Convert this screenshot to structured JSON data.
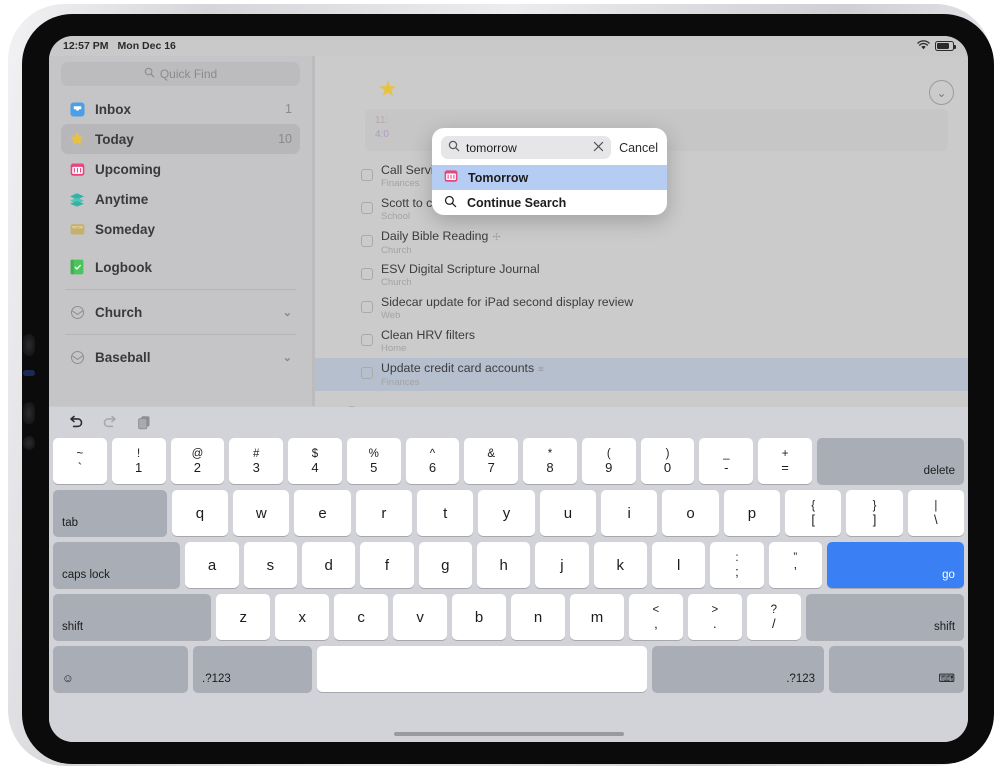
{
  "statusbar": {
    "time": "12:57 PM",
    "date": "Mon Dec 16",
    "wifi_icon": "wifi-icon",
    "battery_icon": "battery-icon"
  },
  "sidebar": {
    "quick_find_placeholder": "Quick Find",
    "search_icon": "search-icon",
    "items": [
      {
        "label": "Inbox",
        "count": "1",
        "icon": "inbox-icon",
        "color": "#4a9fe8",
        "selected": false
      },
      {
        "label": "Today",
        "count": "10",
        "icon": "star-icon",
        "color": "#e8c140",
        "selected": true
      },
      {
        "label": "Upcoming",
        "count": "",
        "icon": "calendar-icon",
        "color": "#e8457c",
        "selected": false
      },
      {
        "label": "Anytime",
        "count": "",
        "icon": "layers-icon",
        "color": "#2fb4a6",
        "selected": false
      },
      {
        "label": "Someday",
        "count": "",
        "icon": "box-icon",
        "color": "#c6b06a",
        "selected": false
      },
      {
        "label": "Logbook",
        "count": "",
        "icon": "logbook-icon",
        "color": "#4cc45e",
        "selected": false
      }
    ],
    "areas": [
      {
        "label": "Church",
        "icon": "area-icon",
        "chevron": "chevron-down-icon"
      },
      {
        "label": "Baseball",
        "icon": "area-icon",
        "chevron": "chevron-down-icon"
      }
    ]
  },
  "content": {
    "star_icon": "star-icon",
    "ghost_card": {
      "line1": "11:",
      "line2": "4:0"
    },
    "tasks": [
      {
        "title": "Call Service Canada",
        "sub": "Finances",
        "badge": "",
        "selected": false
      },
      {
        "title": "Scott to confirm PER report for PERT",
        "sub": "School",
        "badge": "",
        "selected": false
      },
      {
        "title": "Daily Bible Reading",
        "sub": "Church",
        "badge": "☩",
        "selected": false
      },
      {
        "title": "ESV Digital Scripture Journal",
        "sub": "Church",
        "badge": "",
        "selected": false
      },
      {
        "title": "Sidecar update for iPad second display review",
        "sub": "Web",
        "badge": "",
        "selected": false
      },
      {
        "title": "Clean HRV filters",
        "sub": "Home",
        "badge": "",
        "selected": false
      },
      {
        "title": "Update credit card accounts",
        "sub": "Finances",
        "badge": "≡",
        "selected": true
      }
    ]
  },
  "popover": {
    "search_icon": "search-icon",
    "query": "tomorrow",
    "clear_icon": "close-icon",
    "cancel_label": "Cancel",
    "results": [
      {
        "label": "Tomorrow",
        "icon": "calendar-icon",
        "highlighted": true
      },
      {
        "label": "Continue Search",
        "icon": "search-icon",
        "highlighted": false
      }
    ]
  },
  "toolbar": {
    "undo_icon": "undo-icon",
    "redo_icon": "redo-icon",
    "paste_icon": "paste-icon",
    "collapse_icon": "chevron-down-circle-icon"
  },
  "keyboard": {
    "rows": [
      [
        {
          "type": "dual",
          "up": "~",
          "lo": "`",
          "name": "key-backtick"
        },
        {
          "type": "dual",
          "up": "!",
          "lo": "1",
          "name": "key-1"
        },
        {
          "type": "dual",
          "up": "@",
          "lo": "2",
          "name": "key-2"
        },
        {
          "type": "dual",
          "up": "#",
          "lo": "3",
          "name": "key-3"
        },
        {
          "type": "dual",
          "up": "$",
          "lo": "4",
          "name": "key-4"
        },
        {
          "type": "dual",
          "up": "%",
          "lo": "5",
          "name": "key-5"
        },
        {
          "type": "dual",
          "up": "^",
          "lo": "6",
          "name": "key-6"
        },
        {
          "type": "dual",
          "up": "&",
          "lo": "7",
          "name": "key-7"
        },
        {
          "type": "dual",
          "up": "*",
          "lo": "8",
          "name": "key-8"
        },
        {
          "type": "dual",
          "up": "(",
          "lo": "9",
          "name": "key-9"
        },
        {
          "type": "dual",
          "up": ")",
          "lo": "0",
          "name": "key-0"
        },
        {
          "type": "dual",
          "up": "_",
          "lo": "-",
          "name": "key-minus"
        },
        {
          "type": "dual",
          "up": "+",
          "lo": "=",
          "name": "key-equals"
        },
        {
          "type": "mod-right",
          "label": "delete",
          "flex": 2.4,
          "name": "key-delete"
        }
      ],
      [
        {
          "type": "mod-left",
          "label": "tab",
          "flex": 1.7,
          "name": "key-tab"
        },
        {
          "type": "single",
          "label": "q",
          "name": "key-q"
        },
        {
          "type": "single",
          "label": "w",
          "name": "key-w"
        },
        {
          "type": "single",
          "label": "e",
          "name": "key-e"
        },
        {
          "type": "single",
          "label": "r",
          "name": "key-r"
        },
        {
          "type": "single",
          "label": "t",
          "name": "key-t"
        },
        {
          "type": "single",
          "label": "y",
          "name": "key-y"
        },
        {
          "type": "single",
          "label": "u",
          "name": "key-u"
        },
        {
          "type": "single",
          "label": "i",
          "name": "key-i"
        },
        {
          "type": "single",
          "label": "o",
          "name": "key-o"
        },
        {
          "type": "single",
          "label": "p",
          "name": "key-p"
        },
        {
          "type": "dual",
          "up": "{",
          "lo": "[",
          "name": "key-bracket-left"
        },
        {
          "type": "dual",
          "up": "}",
          "lo": "]",
          "name": "key-bracket-right"
        },
        {
          "type": "dual",
          "up": "|",
          "lo": "\\",
          "name": "key-backslash"
        }
      ],
      [
        {
          "type": "mod-left",
          "label": "caps lock",
          "flex": 2.05,
          "name": "key-caps-lock"
        },
        {
          "type": "single",
          "label": "a",
          "name": "key-a"
        },
        {
          "type": "single",
          "label": "s",
          "name": "key-s"
        },
        {
          "type": "single",
          "label": "d",
          "name": "key-d"
        },
        {
          "type": "single",
          "label": "f",
          "name": "key-f"
        },
        {
          "type": "single",
          "label": "g",
          "name": "key-g"
        },
        {
          "type": "single",
          "label": "h",
          "name": "key-h"
        },
        {
          "type": "single",
          "label": "j",
          "name": "key-j"
        },
        {
          "type": "single",
          "label": "k",
          "name": "key-k"
        },
        {
          "type": "single",
          "label": "l",
          "name": "key-l"
        },
        {
          "type": "dual",
          "up": ":",
          "lo": ";",
          "name": "key-semicolon"
        },
        {
          "type": "dual",
          "up": "”",
          "lo": "’",
          "name": "key-quote"
        },
        {
          "type": "go",
          "label": "go",
          "flex": 2.4,
          "name": "key-go"
        }
      ],
      [
        {
          "type": "mod-left",
          "label": "shift",
          "flex": 2.6,
          "name": "key-shift-left"
        },
        {
          "type": "single",
          "label": "z",
          "name": "key-z"
        },
        {
          "type": "single",
          "label": "x",
          "name": "key-x"
        },
        {
          "type": "single",
          "label": "c",
          "name": "key-c"
        },
        {
          "type": "single",
          "label": "v",
          "name": "key-v"
        },
        {
          "type": "single",
          "label": "b",
          "name": "key-b"
        },
        {
          "type": "single",
          "label": "n",
          "name": "key-n"
        },
        {
          "type": "single",
          "label": "m",
          "name": "key-m"
        },
        {
          "type": "dual",
          "up": "<",
          "lo": ",",
          "name": "key-comma"
        },
        {
          "type": "dual",
          "up": ">",
          "lo": ".",
          "name": "key-period"
        },
        {
          "type": "dual",
          "up": "?",
          "lo": "/",
          "name": "key-slash"
        },
        {
          "type": "mod-right",
          "label": "shift",
          "flex": 2.6,
          "name": "key-shift-right"
        }
      ],
      [
        {
          "type": "mod-left",
          "label": "☺",
          "flex": 2.2,
          "name": "key-emoji"
        },
        {
          "type": "mod-left",
          "label": ".?123",
          "flex": 1.9,
          "name": "key-numbers-left"
        },
        {
          "type": "space",
          "label": "",
          "flex": 6.2,
          "name": "key-space"
        },
        {
          "type": "mod-right",
          "label": ".?123",
          "flex": 2.9,
          "name": "key-numbers-right"
        },
        {
          "type": "mod-right",
          "label": "⌨",
          "flex": 2.2,
          "name": "key-dismiss-keyboard"
        }
      ]
    ]
  }
}
